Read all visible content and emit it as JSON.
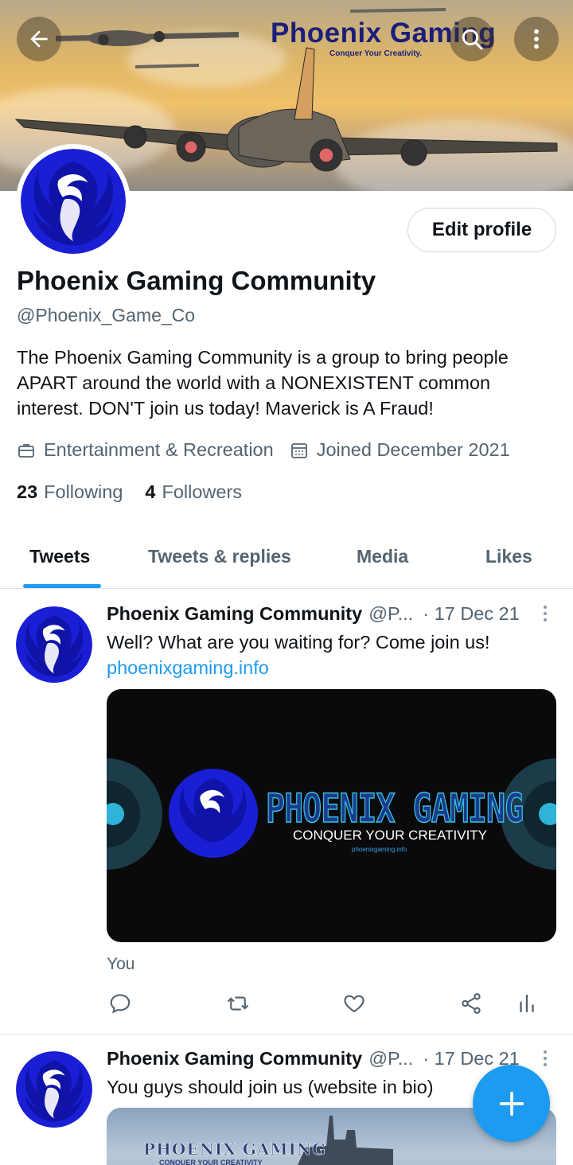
{
  "banner": {
    "brand_name": "Phoenix Gaming",
    "brand_tagline": "Conquer Your Creativity."
  },
  "toolbar": {
    "back_icon": "arrow-left-icon",
    "search_icon": "search-icon",
    "more_icon": "more-vertical-icon"
  },
  "profile": {
    "edit_label": "Edit profile",
    "display_name": "Phoenix Gaming Community",
    "handle": "@Phoenix_Game_Co",
    "bio": "The Phoenix Gaming Community is a group to bring people APART around the world with a NONEXISTENT common interest.  DON'T join us today! Maverick is A Fraud!",
    "category": "Entertainment & Recreation",
    "joined": "Joined December 2021",
    "following_count": "23",
    "following_label": "Following",
    "followers_count": "4",
    "followers_label": "Followers"
  },
  "tabs": [
    {
      "label": "Tweets",
      "active": true
    },
    {
      "label": "Tweets & replies",
      "active": false
    },
    {
      "label": "Media",
      "active": false
    },
    {
      "label": "Likes",
      "active": false
    }
  ],
  "tweets": [
    {
      "name": "Phoenix Gaming Community",
      "handle": "@P...",
      "date": "· 17 Dec 21",
      "text": "Well? What are you waiting for? Come join us!",
      "link": "phoenixgaming.info",
      "media_title": "PHOENIX GAMING",
      "media_subtitle": "CONQUER YOUR CREATIVITY",
      "media_url": "phoenixgaming.info",
      "footer": "You"
    },
    {
      "name": "Phoenix Gaming Community",
      "handle": "@P...",
      "date": "· 17 Dec 21",
      "text": "You guys should join us (website in bio)",
      "media_title": "PHOENIX GAMING",
      "media_subtitle": "CONQUER YOUR CREATIVITY"
    }
  ],
  "colors": {
    "accent": "#1d9bf0",
    "text_primary": "#0f1419",
    "text_secondary": "#536471",
    "phoenix_blue": "#1a1fd6"
  }
}
